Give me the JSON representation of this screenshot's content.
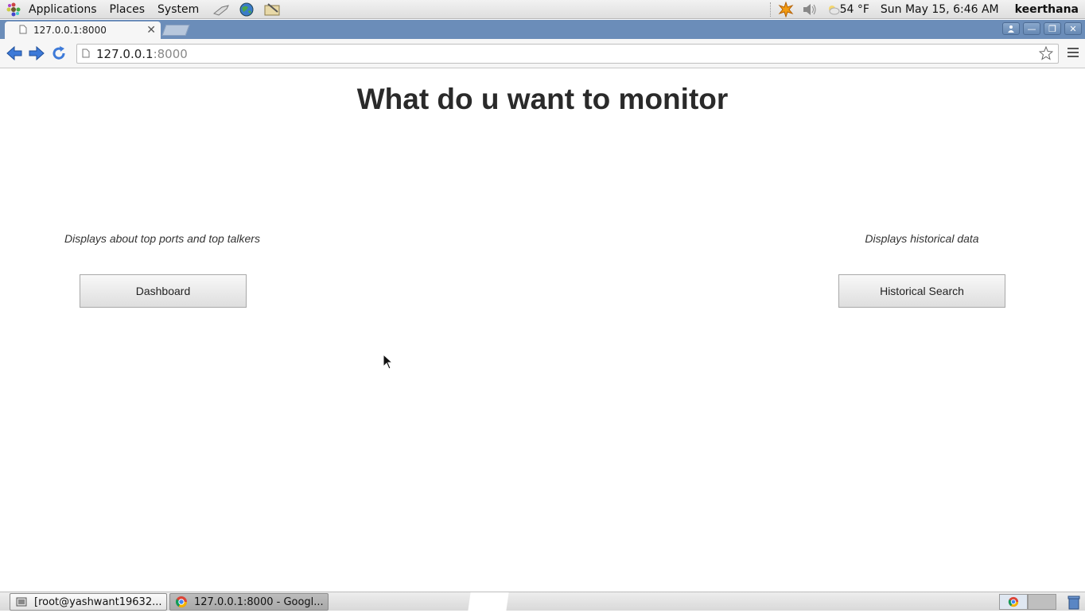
{
  "top_panel": {
    "menus": [
      "Applications",
      "Places",
      "System"
    ],
    "launchers": [
      "network-tool-icon",
      "web-browser-icon",
      "text-editor-icon"
    ],
    "tray": [
      "update-notifier-icon",
      "volume-icon"
    ],
    "weather": "54 °F",
    "clock": "Sun May 15,  6:46 AM",
    "user": "keerthana"
  },
  "browser": {
    "tab_title": "127.0.0.1:8000",
    "url_host": "127.0.0.1",
    "url_port": ":8000"
  },
  "page": {
    "title": "What do u want to monitor",
    "left_description": "Displays about top ports and top talkers",
    "left_button": "Dashboard",
    "right_description": "Displays historical data",
    "right_button": "Historical Search"
  },
  "taskbar": {
    "tasks": [
      "[root@yashwant19632...",
      "127.0.0.1:8000 - Googl..."
    ]
  },
  "colors": {
    "tabstrip": "#6b8db9",
    "title_text": "#2a2a2a"
  }
}
